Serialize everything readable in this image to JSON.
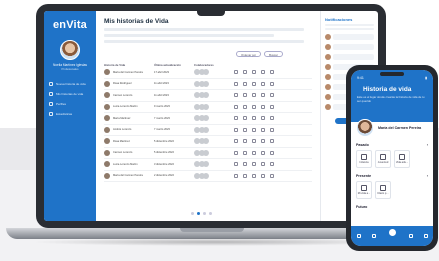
{
  "app": {
    "logo": "enVita"
  },
  "sidebar": {
    "user_name": "Noelia Martínez Iglesias",
    "user_role": "Profesionales",
    "items": [
      {
        "label": "Nueva historia de vida"
      },
      {
        "label": "Mis historias de vida"
      },
      {
        "label": "Perfiles"
      },
      {
        "label": "Estadísticas"
      }
    ]
  },
  "main": {
    "title": "Mis historias de Vida",
    "filters": [
      {
        "label": "Ordenar por"
      },
      {
        "label": "Buscar"
      }
    ],
    "columns": [
      "Historia de Vida",
      "Última actualización",
      "Colaboradores"
    ],
    "rows": [
      {
        "name": "María del Carmen Pereira",
        "date": "17 abril 2023"
      },
      {
        "name": "Rosa Rodríguez",
        "date": "11 abril 2023"
      },
      {
        "name": "Carmen Lorenzo",
        "date": "11 abril 2023"
      },
      {
        "name": "Lucía Lorenzo Martín",
        "date": "9 marzo 2023"
      },
      {
        "name": "María Martínez",
        "date": "7 marzo 2023"
      },
      {
        "name": "Andrés Lorenzo",
        "date": "7 marzo 2023"
      },
      {
        "name": "Rosa Martínez",
        "date": "5 diciembre 2022"
      },
      {
        "name": "Carmen Lorenzo",
        "date": "5 diciembre 2022"
      },
      {
        "name": "Lucía Lorenzo Martín",
        "date": "3 diciembre 2022"
      },
      {
        "name": "María del Carmen Pereira",
        "date": "2 diciembre 2022"
      }
    ]
  },
  "right_panel": {
    "title": "Notificaciones"
  },
  "phone": {
    "time": "9:41",
    "title": "Historia de vida",
    "subtitle": "Este es el lugar donde crearás la historia de vida de tu ser querido",
    "profile_name": "María del Carmen Pereira",
    "section1": "Pasado",
    "tiles1": [
      {
        "label": "Infancia"
      },
      {
        "label": "Juventud"
      },
      {
        "label": "Vida adu..."
      }
    ],
    "section2": "Presente",
    "tiles2": [
      {
        "label": "Mi vida a..."
      },
      {
        "label": "Diario p..."
      }
    ],
    "section3": "Futuro"
  },
  "colors": {
    "brand": "#1f73c8",
    "laptop": "#2a2d33"
  }
}
